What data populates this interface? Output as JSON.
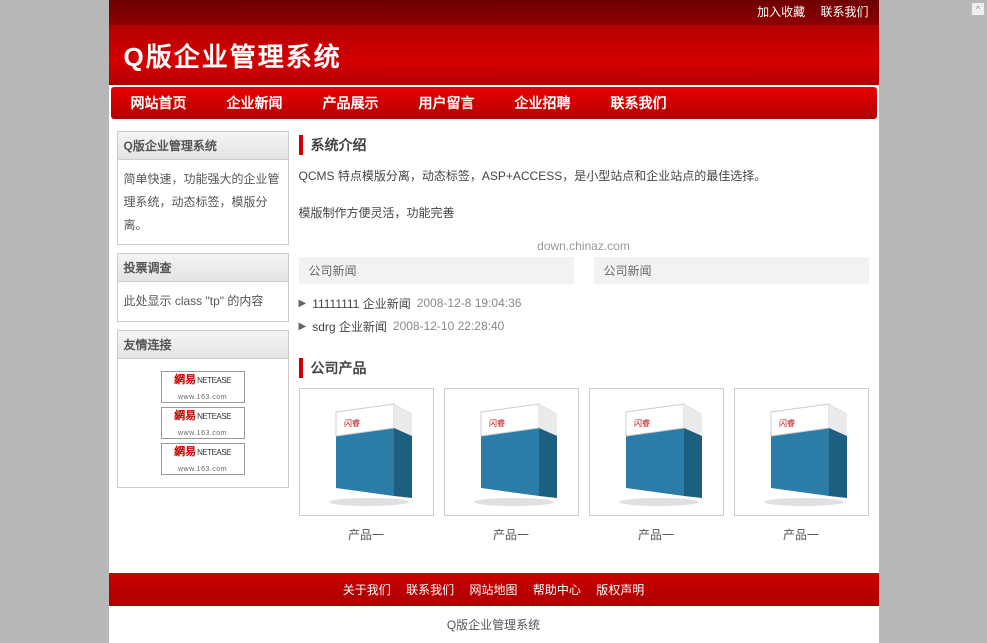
{
  "topbar": {
    "fav": "加入收藏",
    "contact": "联系我们"
  },
  "header": {
    "title": "Q版企业管理系统"
  },
  "nav": [
    {
      "label": "网站首页"
    },
    {
      "label": "企业新闻"
    },
    {
      "label": "产品展示"
    },
    {
      "label": "用户留言"
    },
    {
      "label": "企业招聘"
    },
    {
      "label": "联系我们"
    }
  ],
  "sidebar": {
    "intro_title": "Q版企业管理系统",
    "intro_body": "简单快速，功能强大的企业管理系统，动态标签，模版分离。",
    "poll_title": "投票调查",
    "poll_body": "此处显示 class \"tp\" 的内容",
    "links_title": "友情连接",
    "links": [
      {
        "cn": "網易",
        "en": "NETEASE",
        "domain": "www.163.com"
      },
      {
        "cn": "網易",
        "en": "NETEASE",
        "domain": "www.163.com"
      },
      {
        "cn": "網易",
        "en": "NETEASE",
        "domain": "www.163.com"
      }
    ]
  },
  "main": {
    "intro_heading": "系统介绍",
    "intro_p1": "QCMS 特点模版分离，动态标签，ASP+ACCESS，是小型站点和企业站点的最佳选择。",
    "intro_p2": "模版制作方便灵活，功能完善",
    "watermark": "down.chinaz.com",
    "tab_left": "公司新闻",
    "tab_right": "公司新闻",
    "news": [
      {
        "title": "11111111  企业新闻",
        "ts": "2008-12-8 19:04:36"
      },
      {
        "title": "sdrg  企业新闻",
        "ts": "2008-12-10 22:28:40"
      }
    ],
    "products_heading": "公司产品",
    "product_box_text": "闪睿",
    "products": [
      {
        "name": "产品一"
      },
      {
        "name": "产品一"
      },
      {
        "name": "产品一"
      },
      {
        "name": "产品一"
      }
    ]
  },
  "footer": {
    "nav": [
      {
        "label": "关于我们"
      },
      {
        "label": "联系我们"
      },
      {
        "label": "网站地图"
      },
      {
        "label": "帮助中心"
      },
      {
        "label": "版权声明"
      }
    ],
    "copy": "Q版企业管理系统"
  }
}
